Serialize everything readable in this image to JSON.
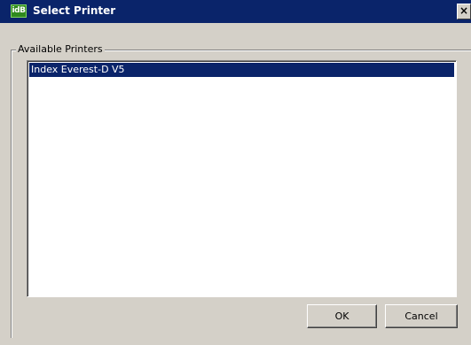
{
  "window": {
    "icon_text": "idB",
    "title": "Select Printer",
    "close_glyph": "×"
  },
  "group": {
    "label": "Available Printers"
  },
  "printers": [
    {
      "name": "Index Everest-D V5",
      "selected": true
    }
  ],
  "buttons": {
    "ok": "OK",
    "cancel": "Cancel"
  },
  "colors": {
    "titlebar": "#0a246a",
    "selection": "#0a246a",
    "dialog_face": "#d4d0c8",
    "app_icon": "#2f8a1e"
  }
}
